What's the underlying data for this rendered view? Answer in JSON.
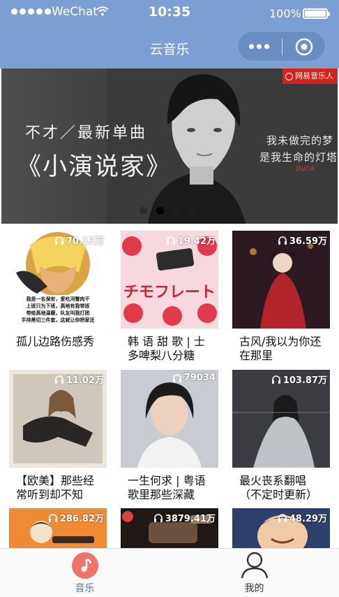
{
  "status_bar": {
    "carrier": "WeChat",
    "time": "10:35",
    "battery": "100%"
  },
  "nav": {
    "title": "云音乐",
    "more_icon": "more-dots-icon",
    "close_icon": "target-circle-icon"
  },
  "banner": {
    "line1": "不才／最新单曲",
    "line2": "《小演说家》",
    "right_line1": "我未做完的梦",
    "right_line2": "是我生命的灯塔",
    "signature": "buca",
    "brand": "网易音乐人",
    "page_count": 4,
    "active_index": 1
  },
  "playlists": [
    {
      "plays": "70.13万",
      "title": "孤儿边路伤感秀"
    },
    {
      "plays": "19.42万",
      "title": "韩 语 甜 歌 | 士多啤梨八分糖"
    },
    {
      "plays": "36.59万",
      "title": "古风/我以为你还在那里"
    },
    {
      "plays": "11.02万",
      "title": "【欧美】那些经常听到却不知道..."
    },
    {
      "plays": "79034",
      "title": "一生何求 | 粤语歌里那些深藏心..."
    },
    {
      "plays": "103.87万",
      "title": "最火丧系翻唱（不定时更新）"
    },
    {
      "plays": "286.82万",
      "title": ""
    },
    {
      "plays": "3879.41万",
      "title": ""
    },
    {
      "plays": "48.29万",
      "title": ""
    }
  ],
  "covers": {
    "c1_caption_1": "我是一名保安，爱吃河蟹肉干",
    "c1_caption_2": "上班只为下班，高地有我带班",
    "c1_caption_3": "带给高地温暖，队友叫我打团",
    "c1_caption_4": "手持黑切三件套，这就让你把家还",
    "c2_text": "チモフレート"
  },
  "tabbar": {
    "music_label": "音乐",
    "me_label": "我的"
  },
  "colors": {
    "nav_bg": "#7b9fd2",
    "tab_active": "#4a78c2",
    "music_icon": "#f0736a"
  }
}
